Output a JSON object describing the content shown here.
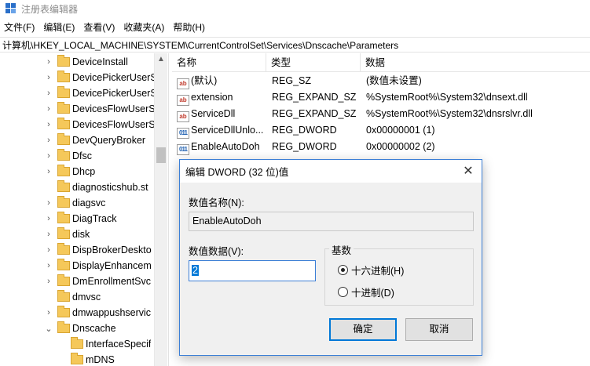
{
  "window": {
    "title": "注册表编辑器"
  },
  "menu": [
    "文件(F)",
    "编辑(E)",
    "查看(V)",
    "收藏夹(A)",
    "帮助(H)"
  ],
  "address": "计算机\\HKEY_LOCAL_MACHINE\\SYSTEM\\CurrentControlSet\\Services\\Dnscache\\Parameters",
  "tree": [
    {
      "label": "DeviceInstall",
      "expander": "›"
    },
    {
      "label": "DevicePickerUserS",
      "expander": "›"
    },
    {
      "label": "DevicePickerUserS",
      "expander": "›"
    },
    {
      "label": "DevicesFlowUserS",
      "expander": "›"
    },
    {
      "label": "DevicesFlowUserS",
      "expander": "›"
    },
    {
      "label": "DevQueryBroker",
      "expander": "›"
    },
    {
      "label": "Dfsc",
      "expander": "›"
    },
    {
      "label": "Dhcp",
      "expander": "›"
    },
    {
      "label": "diagnosticshub.st",
      "expander": ""
    },
    {
      "label": "diagsvc",
      "expander": "›"
    },
    {
      "label": "DiagTrack",
      "expander": "›"
    },
    {
      "label": "disk",
      "expander": "›"
    },
    {
      "label": "DispBrokerDeskto",
      "expander": "›"
    },
    {
      "label": "DisplayEnhancem",
      "expander": "›"
    },
    {
      "label": "DmEnrollmentSvc",
      "expander": "›"
    },
    {
      "label": "dmvsc",
      "expander": ""
    },
    {
      "label": "dmwappushservic",
      "expander": "›"
    },
    {
      "label": "Dnscache",
      "expander": "⌄"
    },
    {
      "label": "InterfaceSpecif",
      "expander": "",
      "child": true
    },
    {
      "label": "mDNS",
      "expander": "",
      "child": true
    }
  ],
  "list": {
    "columns": [
      "名称",
      "类型",
      "数据"
    ],
    "rows": [
      {
        "icon": "ab",
        "name": "(默认)",
        "type": "REG_SZ",
        "data": "(数值未设置)"
      },
      {
        "icon": "ab",
        "name": "extension",
        "type": "REG_EXPAND_SZ",
        "data": "%SystemRoot%\\System32\\dnsext.dll"
      },
      {
        "icon": "ab",
        "name": "ServiceDll",
        "type": "REG_EXPAND_SZ",
        "data": "%SystemRoot%\\System32\\dnsrslvr.dll"
      },
      {
        "icon": "011",
        "name": "ServiceDllUnlo...",
        "type": "REG_DWORD",
        "data": "0x00000001 (1)"
      },
      {
        "icon": "011",
        "name": "EnableAutoDoh",
        "type": "REG_DWORD",
        "data": "0x00000002 (2)"
      }
    ]
  },
  "dialog": {
    "title": "编辑 DWORD (32 位)值",
    "close": "✕",
    "name_label": "数值名称(N):",
    "name_value": "EnableAutoDoh",
    "data_label": "数值数据(V):",
    "data_value": "2",
    "base_label": "基数",
    "hex_label": "十六进制(H)",
    "dec_label": "十进制(D)",
    "selected_base": "hex",
    "ok": "确定",
    "cancel": "取消"
  }
}
